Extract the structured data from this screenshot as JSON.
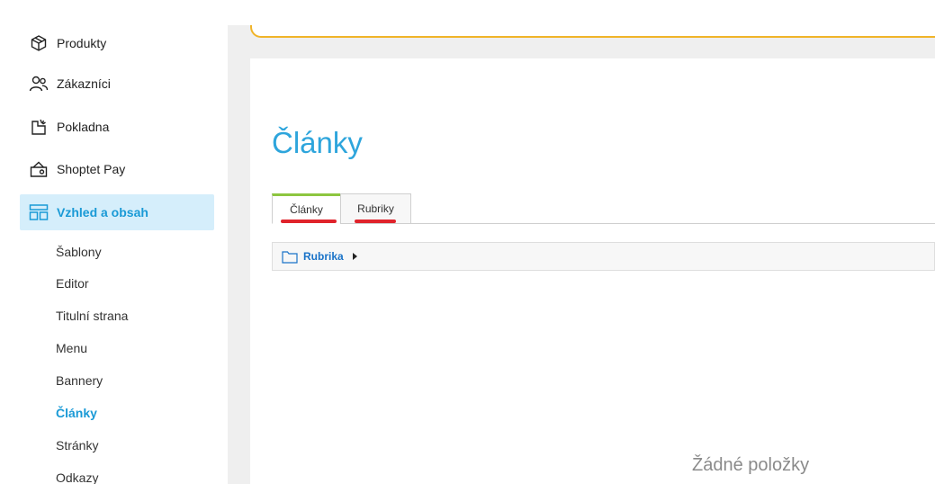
{
  "sidebar": {
    "items": [
      {
        "label": "Produkty",
        "icon": "package-icon"
      },
      {
        "label": "Zákazníci",
        "icon": "users-icon"
      },
      {
        "label": "Pokladna",
        "icon": "cash-register-icon"
      },
      {
        "label": "Shoptet Pay",
        "icon": "wallet-icon"
      },
      {
        "label": "Vzhled a obsah",
        "icon": "layout-icon",
        "active": true
      }
    ],
    "subitems": [
      {
        "label": "Šablony"
      },
      {
        "label": "Editor"
      },
      {
        "label": "Titulní strana"
      },
      {
        "label": "Menu"
      },
      {
        "label": "Bannery"
      },
      {
        "label": "Články",
        "active": true
      },
      {
        "label": "Stránky"
      },
      {
        "label": "Odkazy"
      }
    ]
  },
  "main": {
    "title": "Články",
    "tabs": [
      {
        "label": "Články",
        "active": true
      },
      {
        "label": "Rubriky",
        "active": false
      }
    ],
    "breadcrumb": {
      "label": "Rubrika"
    },
    "empty_text": "Žádné položky"
  },
  "colors": {
    "accent": "#2ea5dc",
    "active_bg": "#d5eefb",
    "tab_active_border": "#8dc63f",
    "annotation_red": "#e0232b",
    "card_border": "#f0b429"
  }
}
